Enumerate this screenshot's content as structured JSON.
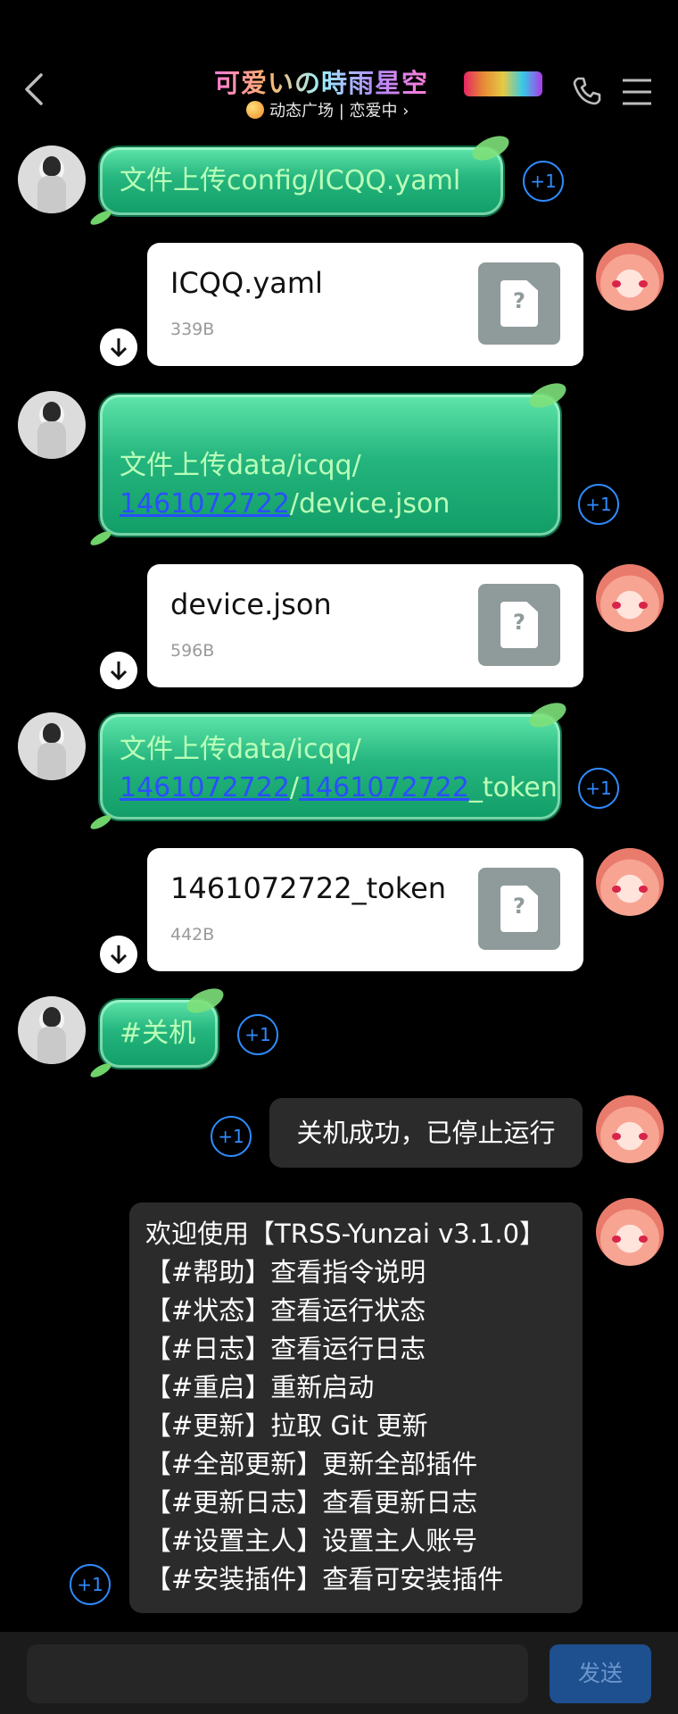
{
  "header": {
    "title": "可爱いの時雨星空",
    "subtitle": "动态广场 | 恋爱中 ›",
    "icons": [
      "back-arrow-icon",
      "phone-icon",
      "menu-icon"
    ]
  },
  "messages": {
    "m1": {
      "text": "文件上传config/ICQQ.yaml"
    },
    "f1": {
      "name": "ICQQ.yaml",
      "size": "339B"
    },
    "m2": {
      "line1": "文件上传data/icqq/",
      "link": "1461072722",
      "suffix": "/device.json"
    },
    "f2": {
      "name": "device.json",
      "size": "596B"
    },
    "m3": {
      "line1": "文件上传data/icqq/",
      "link1": "1461072722",
      "sep": "/",
      "link2": "1461072722",
      "suffix": "_token"
    },
    "f3": {
      "name": "1461072722_token",
      "size": "442B"
    },
    "m4": {
      "text": "#关机"
    },
    "m5": {
      "text": "关机成功，已停止运行"
    },
    "m6": {
      "lines": [
        "欢迎使用【TRSS-Yunzai v3.1.0】",
        "【#帮助】查看指令说明",
        "【#状态】查看运行状态",
        "【#日志】查看运行日志",
        "【#重启】重新启动",
        "【#更新】拉取 Git 更新",
        "【#全部更新】更新全部插件",
        "【#更新日志】查看更新日志",
        "【#设置主人】设置主人账号",
        "【#安装插件】查看可安装插件"
      ]
    }
  },
  "plus_one": "+1",
  "file_icon_glyph": "?",
  "input": {
    "value": "",
    "placeholder": ""
  },
  "send_label": "发送",
  "colors": {
    "bubble_green": "#25b57e",
    "accent_blue": "#2f8bff",
    "send_bg": "#1e4f8f"
  }
}
